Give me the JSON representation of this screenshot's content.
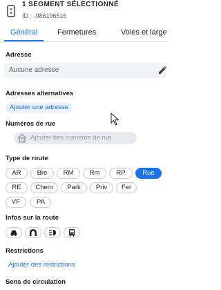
{
  "header": {
    "title": "1 SEGMENT SÉLECTIONNÉ",
    "id_text": "ID : -986196516"
  },
  "tabs": [
    {
      "label": "Général",
      "active": true
    },
    {
      "label": "Fermetures",
      "active": false
    },
    {
      "label": "Voies et large",
      "active": false
    }
  ],
  "address": {
    "label": "Adresse",
    "value": "Aucune adresse"
  },
  "alt_addresses": {
    "label": "Adresses alternatives",
    "button": "Ajouter une adresse"
  },
  "street_numbers": {
    "label": "Numéros de rue",
    "button": "Ajouter des numéros de rue"
  },
  "road_type": {
    "label": "Type de route",
    "options": [
      "AR",
      "Bre",
      "RM",
      "Rm",
      "RP",
      "Rue",
      "RE",
      "Chem",
      "Park",
      "Priv",
      "Fer",
      "VF",
      "PA"
    ],
    "selected": "Rue"
  },
  "road_info": {
    "label": "Infos sur la route",
    "icons": [
      "car-icon",
      "tunnel-icon",
      "headlights-icon",
      "bus-icon"
    ]
  },
  "restrictions": {
    "label": "Restrictions",
    "button": "Ajouter des restrictions"
  },
  "direction": {
    "label": "Sens de circulation"
  },
  "colors": {
    "accent": "#1a73e8",
    "chip_border": "#c7cacf",
    "soft_button_bg": "#eaf1fb"
  }
}
